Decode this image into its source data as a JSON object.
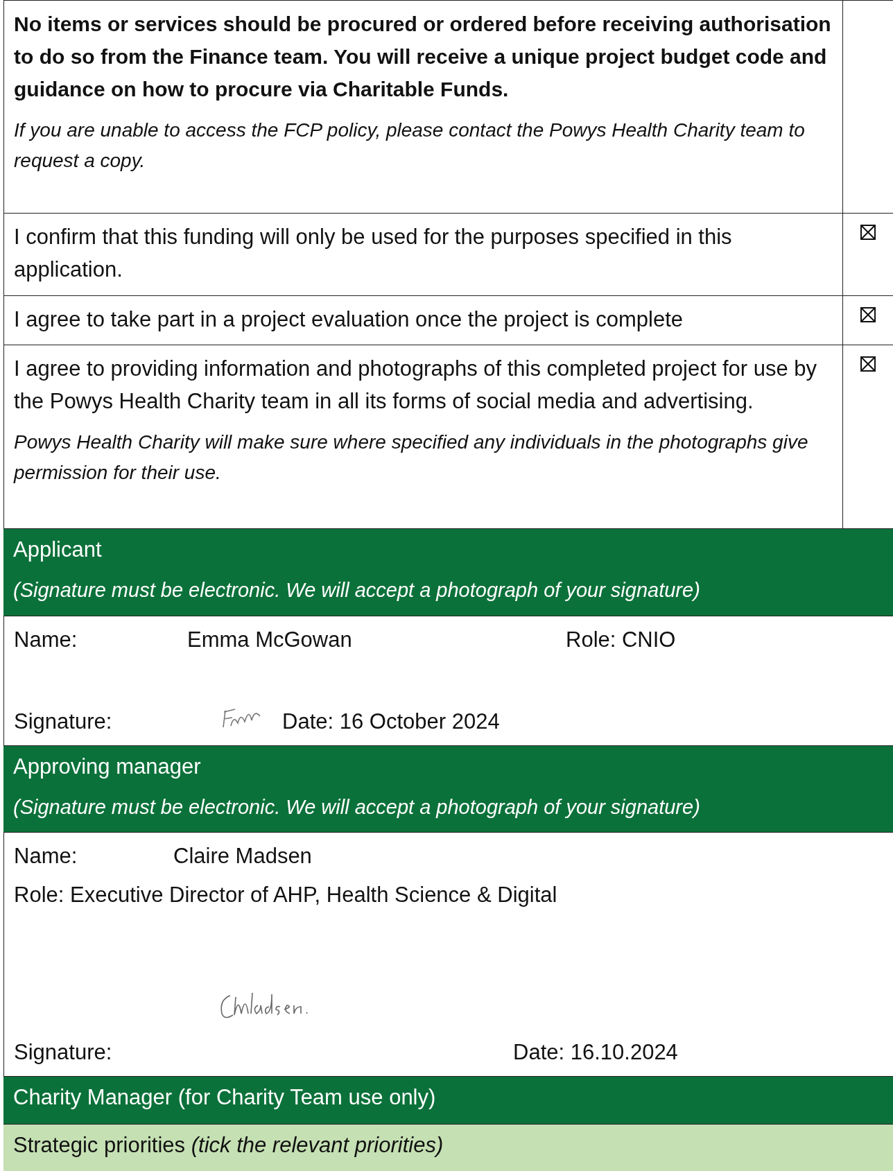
{
  "notice": {
    "text": "No items or services should be procured or ordered before receiving authorisation to do so from the Finance team. You will receive a unique project budget code and guidance on how to procure via Charitable Funds.",
    "note": "If you are unable to access the FCP policy, please contact the Powys Health Charity team to request a copy."
  },
  "declarations": [
    {
      "text": "I confirm that this funding will only be used for the purposes specified in this application.",
      "checked": true
    },
    {
      "text": "I agree to take part in a project evaluation once the project is complete",
      "checked": true
    },
    {
      "text": "I agree to providing information and photographs of this completed project for use by the Powys Health Charity team in all its forms of social media and advertising.",
      "note": "Powys Health Charity will make sure where specified any individuals in the photographs give permission for their use.",
      "checked": true
    }
  ],
  "applicant": {
    "title": "Applicant",
    "subtitle": "(Signature must be electronic. We will accept a photograph of your signature)",
    "name_label": "Name:",
    "name": "Emma McGowan",
    "role": "Role:  CNIO",
    "signature_label": "Signature:",
    "date": "Date: 16 October 2024"
  },
  "approving_manager": {
    "title": "Approving manager",
    "subtitle": "(Signature must be electronic. We will accept a photograph of your signature)",
    "name_label": "Name:",
    "name": "Claire Madsen",
    "role": "Role: Executive Director of AHP, Health Science & Digital",
    "signature_label": "Signature:",
    "date": "Date: 16.10.2024"
  },
  "charity_manager": {
    "title": "Charity Manager (for Charity Team use only)"
  },
  "strategic_priorities": {
    "title": "Strategic priorities *(tick the relevant priorities)*"
  }
}
